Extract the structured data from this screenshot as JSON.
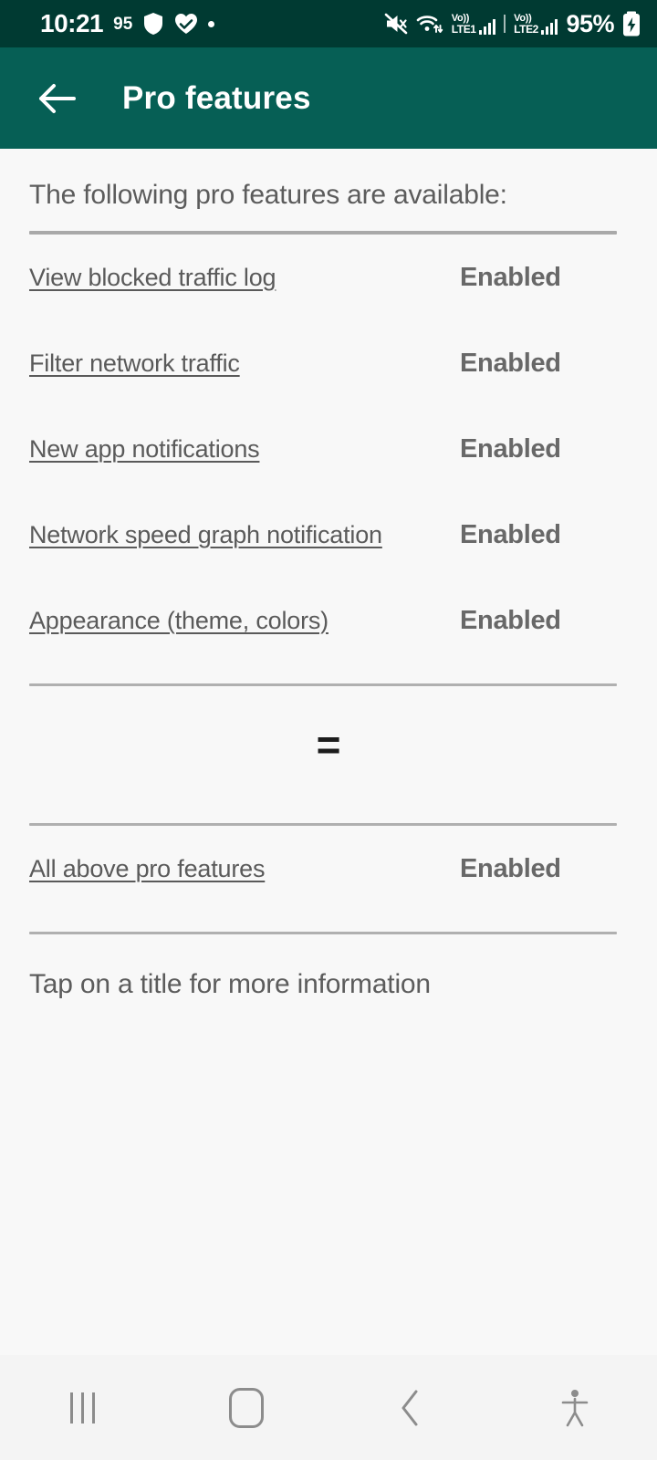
{
  "status_bar": {
    "time": "10:21",
    "badge_count": "95",
    "battery_percent": "95%",
    "left_icons": [
      "shield-icon",
      "heart-health-icon",
      "dot-indicator-icon"
    ],
    "right_icons": [
      "mute-icon",
      "wifi-icon",
      "volte1-signal-icon",
      "volte2-signal-icon",
      "battery-charging-icon"
    ],
    "volte1_label_top": "Vo))",
    "volte1_label_bottom": "LTE1",
    "volte2_label_top": "Vo))",
    "volte2_label_bottom": "LTE2",
    "background_color": "#003a32"
  },
  "app_bar": {
    "back_icon": "arrow-left-icon",
    "title": "Pro features",
    "background_color": "#065f55",
    "text_color": "#ffffff"
  },
  "content": {
    "intro_text": "The following pro features are available:",
    "features": [
      {
        "label": "View blocked traffic log",
        "status": "Enabled"
      },
      {
        "label": "Filter network traffic",
        "status": "Enabled"
      },
      {
        "label": "New app notifications",
        "status": "Enabled"
      },
      {
        "label": "Network speed graph notification",
        "status": "Enabled"
      },
      {
        "label": "Appearance (theme, colors)",
        "status": "Enabled"
      }
    ],
    "equals_symbol": "=",
    "bundle": {
      "label": "All above pro features",
      "status": "Enabled"
    },
    "footnote": "Tap on a title for more information",
    "link_color": "#5a5a5a",
    "status_color": "#686868",
    "divider_color": "#a9a9a9",
    "background_color": "#f8f8f8"
  },
  "nav_bar": {
    "buttons": [
      {
        "name": "recents-button",
        "icon": "recents-icon"
      },
      {
        "name": "home-button",
        "icon": "home-icon"
      },
      {
        "name": "back-button",
        "icon": "chevron-left-icon"
      },
      {
        "name": "accessibility-button",
        "icon": "accessibility-icon"
      }
    ],
    "icon_color": "#8c8c8c",
    "background_color": "#f4f4f4"
  }
}
